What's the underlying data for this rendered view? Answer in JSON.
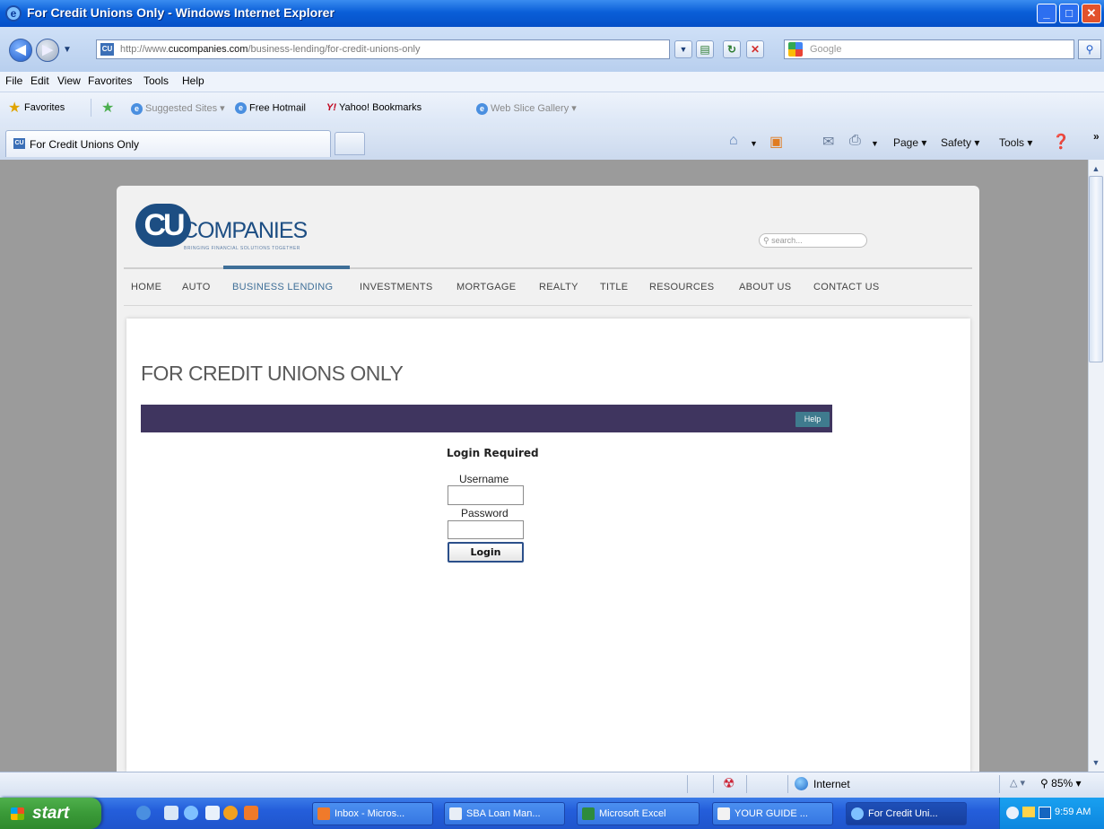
{
  "window": {
    "title": "For Credit Unions Only - Windows Internet Explorer",
    "minimize_glyph": "_",
    "maximize_glyph": "□",
    "close_glyph": "✕"
  },
  "address": {
    "url_prefix": "http://www.",
    "url_domain": "cucompanies.com",
    "url_path": "/business-lending/for-credit-unions-only"
  },
  "search": {
    "placeholder": "Google"
  },
  "menu": [
    "File",
    "Edit",
    "View",
    "Favorites",
    "Tools",
    "Help"
  ],
  "favorites_bar": {
    "favorites_label": "Favorites",
    "suggested_sites": "Suggested Sites ▾",
    "free_hotmail": "Free Hotmail",
    "yahoo": "Yahoo! Bookmarks",
    "web_slice": "Web Slice Gallery ▾"
  },
  "tab": {
    "label": "For Credit Unions Only"
  },
  "command_bar": {
    "page": "Page ▾",
    "safety": "Safety ▾",
    "tools": "Tools ▾",
    "chevron": "»"
  },
  "site": {
    "logo_mark": "CU",
    "logo_text": "COMPANIES",
    "logo_tagline": "BRINGING FINANCIAL SOLUTIONS TOGETHER",
    "search_placeholder": "search...",
    "nav": [
      "HOME",
      "AUTO",
      "BUSINESS LENDING",
      "INVESTMENTS",
      "MORTGAGE",
      "REALTY",
      "TITLE",
      "RESOURCES",
      "ABOUT US",
      "CONTACT US"
    ],
    "page_heading": "FOR CREDIT UNIONS ONLY",
    "help": "Help",
    "login": {
      "title": "Login Required",
      "username_label": "Username",
      "password_label": "Password",
      "button": "Login"
    }
  },
  "status_bar": {
    "zone": "Internet",
    "zoom": "85%"
  },
  "taskbar": {
    "start": "start",
    "tasks": [
      "Inbox - Micros...",
      "SBA Loan Man...",
      "Microsoft Excel",
      "YOUR GUIDE ...",
      "For Credit Uni..."
    ],
    "clock": "9:59 AM"
  },
  "colors": {
    "brand": "#1d4e83",
    "nav_active": "#3f6f98",
    "header_bar": "#3f355f",
    "help_button": "#3f7b8e"
  }
}
